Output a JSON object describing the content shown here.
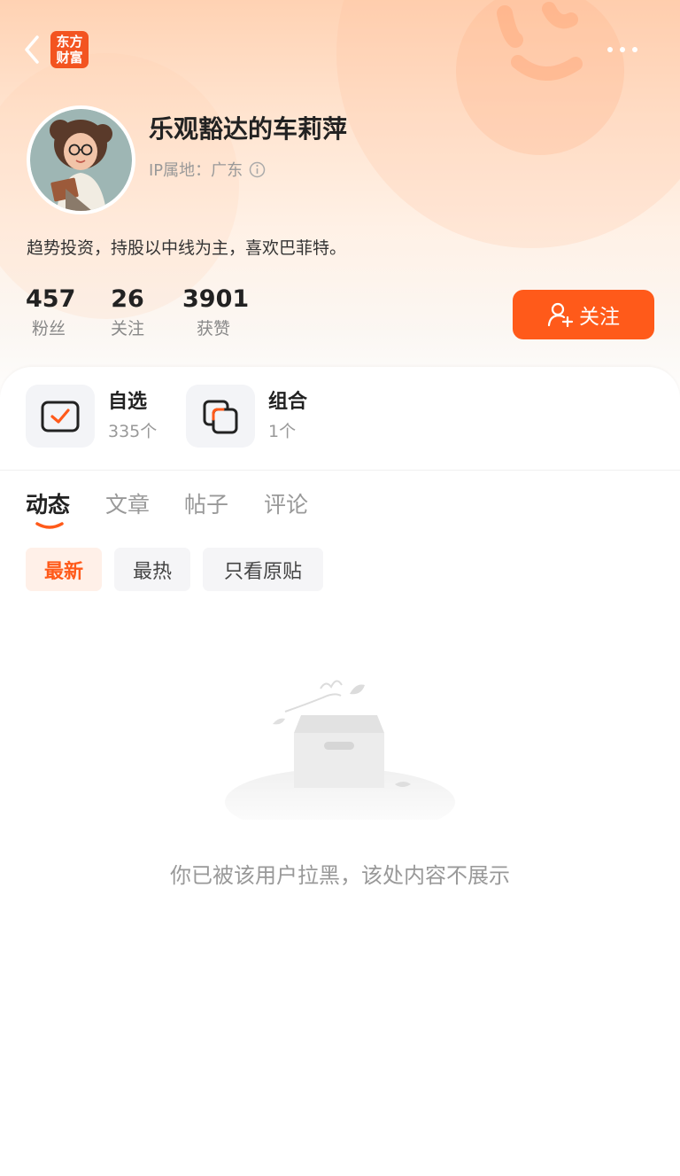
{
  "header": {
    "logo_line1": "东方",
    "logo_line2": "财富",
    "back_icon": "chevron-left-icon",
    "more_icon": "more-horizontal-icon"
  },
  "profile": {
    "username": "乐观豁达的车莉萍",
    "ip_label": "IP属地：广东",
    "bio": "趋势投资，持股以中线为主，喜欢巴菲特。",
    "stats": [
      {
        "value": "457",
        "label": "粉丝"
      },
      {
        "value": "26",
        "label": "关注"
      },
      {
        "value": "3901",
        "label": "获赞"
      }
    ],
    "follow_label": "关注"
  },
  "features": [
    {
      "title": "自选",
      "subtitle": "335个",
      "icon": "watchlist-check-icon"
    },
    {
      "title": "组合",
      "subtitle": "1个",
      "icon": "portfolio-icon"
    }
  ],
  "tabs": [
    {
      "label": "动态",
      "active": true
    },
    {
      "label": "文章",
      "active": false
    },
    {
      "label": "帖子",
      "active": false
    },
    {
      "label": "评论",
      "active": false
    }
  ],
  "filters": [
    {
      "label": "最新",
      "active": true
    },
    {
      "label": "最热",
      "active": false
    },
    {
      "label": "只看原贴",
      "active": false
    }
  ],
  "empty_message": "你已被该用户拉黑，该处内容不展示",
  "colors": {
    "accent": "#ff5a1a",
    "brand_logo": "#f35420",
    "chip_active_bg": "#fff0e8"
  }
}
